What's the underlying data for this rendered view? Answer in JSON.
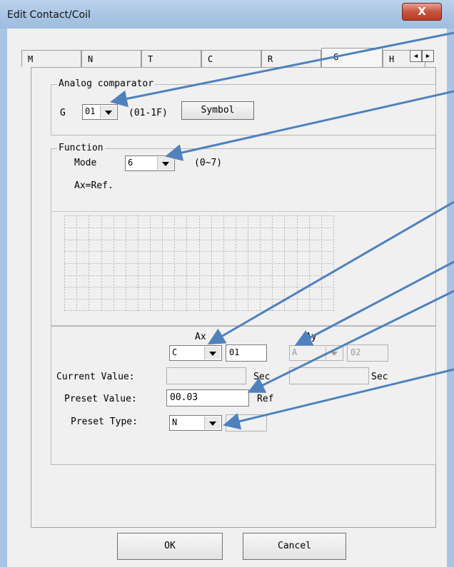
{
  "window": {
    "title": "Edit Contact/Coil",
    "close_glyph": "X"
  },
  "tabs": [
    "M",
    "N",
    "T",
    "C",
    "R",
    "G",
    "H"
  ],
  "selected_tab": "G",
  "analog_group": {
    "legend": "Analog comparator",
    "g_label": "G",
    "g_value": "01",
    "range": "(01-1F)",
    "symbol_button": "Symbol"
  },
  "function_group": {
    "legend": "Function",
    "mode_label": "Mode",
    "mode_value": "6",
    "mode_range": "(0~7)",
    "formula": "Ax=Ref."
  },
  "params": {
    "ax_label": "Ax",
    "ax_type": "C",
    "ax_num": "01",
    "ay_label": "Ay",
    "ay_type": "A",
    "ay_num": "02",
    "current_value_label": "Current Value:",
    "sec1": "Sec",
    "sec2": "Sec",
    "preset_value_label": "Preset Value:",
    "preset_value": "00.03",
    "ref_label": "Ref",
    "preset_type_label": "Preset Type:",
    "preset_type": "N"
  },
  "buttons": {
    "ok": "OK",
    "cancel": "Cancel"
  },
  "colors": {
    "arrow": "#4f81bd",
    "title_bar": "#a9c4e4",
    "close": "#c7543f"
  }
}
